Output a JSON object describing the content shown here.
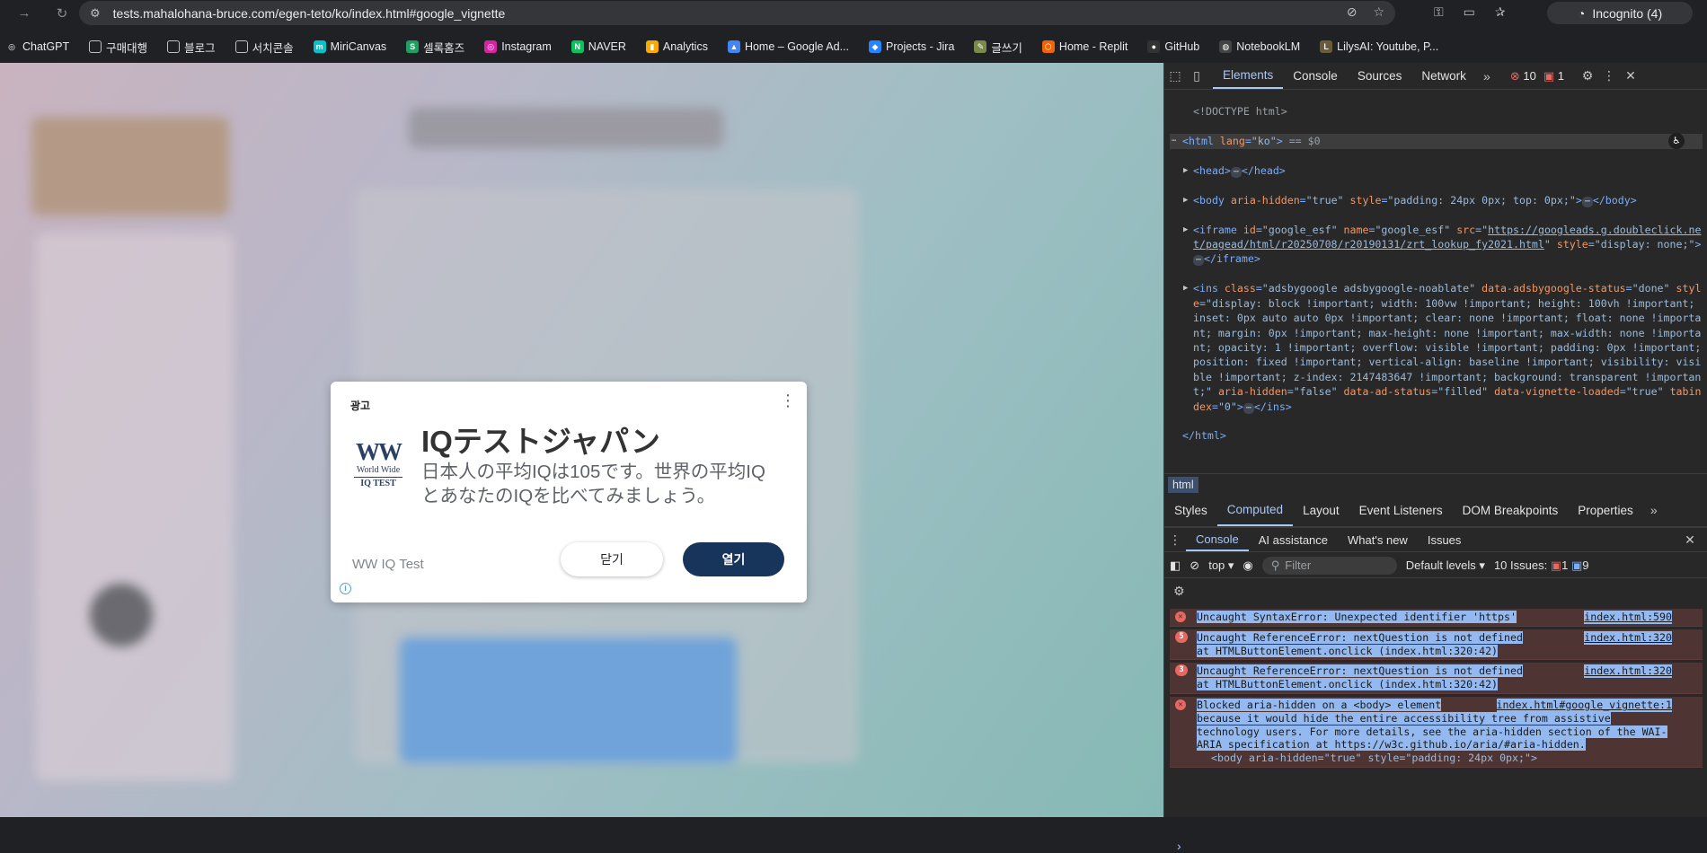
{
  "browser": {
    "url": "tests.mahalohana-bruce.com/egen-teto/ko/index.html#google_vignette",
    "incognito_label": "Incognito (4)"
  },
  "bookmarks": [
    {
      "label": "ChatGPT",
      "icon": "chatgpt-icon"
    },
    {
      "label": "구매대행",
      "icon": "folder-icon"
    },
    {
      "label": "블로그",
      "icon": "folder-icon"
    },
    {
      "label": "서치콘솔",
      "icon": "folder-icon"
    },
    {
      "label": "MiriCanvas",
      "icon": "miricanvas-icon"
    },
    {
      "label": "셀록홈즈",
      "icon": "sellock-icon"
    },
    {
      "label": "Instagram",
      "icon": "instagram-icon"
    },
    {
      "label": "NAVER",
      "icon": "naver-icon"
    },
    {
      "label": "Analytics",
      "icon": "analytics-icon"
    },
    {
      "label": "Home – Google Ad...",
      "icon": "google-ads-icon"
    },
    {
      "label": "Projects - Jira",
      "icon": "jira-icon"
    },
    {
      "label": "글쓰기",
      "icon": "write-icon"
    },
    {
      "label": "Home - Replit",
      "icon": "replit-icon"
    },
    {
      "label": "GitHub",
      "icon": "github-icon"
    },
    {
      "label": "NotebookLM",
      "icon": "notebooklm-icon"
    },
    {
      "label": "LilysAI: Youtube, P...",
      "icon": "lilys-icon"
    }
  ],
  "ad": {
    "label": "광고",
    "logo_mark": "WW",
    "logo_line1": "World Wide",
    "logo_line2": "IQ TEST",
    "title": "IQテストジャパン",
    "body": "日本人の平均IQは105です。世界の平均IQとあなたのIQを比べてみましょう。",
    "advertiser": "WW IQ Test",
    "close_label": "닫기",
    "open_label": "열기"
  },
  "devtools": {
    "tabs": [
      "Elements",
      "Console",
      "Sources",
      "Network"
    ],
    "active_tab": "Elements",
    "error_count": "10",
    "warning_count": "1",
    "dom": {
      "doctype": "<!DOCTYPE html>",
      "html_open_lang": "\"ko\"",
      "html_eq": "== $0",
      "head": "<head>",
      "head_close": "</head>",
      "body_style": "\"padding: 24px 0px; top: 0px;\"",
      "iframe_src": "https://googleads.g.doubleclick.net/pagead/html/r20250708/r20190131/zrt_lookup_fy2021.html",
      "iframe_style": "\"display: none;\"",
      "ins_class": "\"adsbygoogle adsbygoogle-noablate\"",
      "ins_status": "\"done\"",
      "ins_style": "\"display: block !important; width: 100vw !important; height: 100vh !important; inset: 0px auto auto 0px !important; clear: none !important; float: none !important; margin: 0px !important; max-height: none !important; max-width: none !important; opacity: 1 !important; overflow: visible !important; padding: 0px !important; position: fixed !important; vertical-align: baseline !important; visibility: visible !important; z-index: 2147483647 !important; background: transparent !important;\"",
      "html_close": "</html>"
    },
    "breadcrumb": "html",
    "sub_tabs": [
      "Styles",
      "Computed",
      "Layout",
      "Event Listeners",
      "DOM Breakpoints",
      "Properties"
    ],
    "active_sub_tab": "Computed",
    "drawer_tabs": [
      "Console",
      "AI assistance",
      "What's new",
      "Issues"
    ],
    "console_context": "top",
    "filter_placeholder": "Filter",
    "levels": "Default levels",
    "issues_label": "10 Issues:",
    "issues_errors": "1",
    "issues_info": "9",
    "messages": [
      {
        "count": "",
        "text": "Uncaught SyntaxError: Unexpected identifier 'https'",
        "source": "index.html:590"
      },
      {
        "count": "5",
        "text": "Uncaught ReferenceError: nextQuestion is not defined",
        "text2": "    at HTMLButtonElement.onclick (index.html:320:42)",
        "source": "index.html:320"
      },
      {
        "count": "3",
        "text": "Uncaught ReferenceError: nextQuestion is not defined",
        "text2": "    at HTMLButtonElement.onclick (index.html:320:42)",
        "source": "index.html:320"
      },
      {
        "count": "",
        "text": "Blocked aria-hidden on a <body> element",
        "text2": "because it would hide the entire accessibility tree from assistive technology users. For more details, see the aria-hidden section of the WAI-ARIA specification at https://w3c.github.io/aria/#aria-hidden.",
        "text3": "<body aria-hidden=\"true\" style=\"padding: 24px 0px;\">",
        "source": "index.html#google_vignette:1"
      }
    ]
  }
}
